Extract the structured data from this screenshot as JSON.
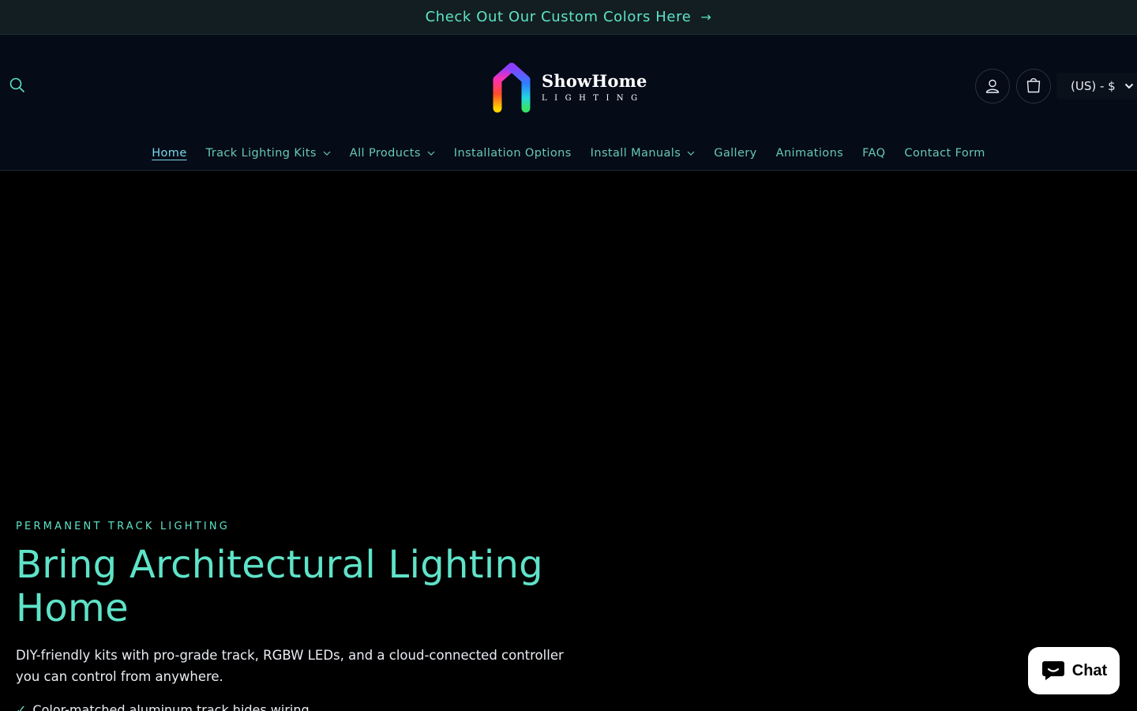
{
  "announcement": {
    "text": "Check Out Our Custom Colors Here",
    "arrow": "→"
  },
  "header": {
    "logo": {
      "name": "ShowHome",
      "sub": "LIGHTING"
    },
    "currency": {
      "label": "(US) - $"
    }
  },
  "nav": {
    "items": [
      {
        "label": "Home",
        "active": true,
        "dropdown": false
      },
      {
        "label": "Track Lighting Kits",
        "dropdown": true
      },
      {
        "label": "All Products",
        "dropdown": true
      },
      {
        "label": "Installation Options",
        "dropdown": false
      },
      {
        "label": "Install Manuals",
        "dropdown": true
      },
      {
        "label": "Gallery",
        "dropdown": false
      },
      {
        "label": "Animations",
        "dropdown": false
      },
      {
        "label": "FAQ",
        "dropdown": false
      },
      {
        "label": "Contact Form",
        "dropdown": false
      }
    ]
  },
  "hero": {
    "eyebrow": "PERMANENT TRACK LIGHTING",
    "title": "Bring Architectural Lighting Home",
    "description": "DIY-friendly kits with pro-grade track, RGBW LEDs, and a cloud-connected controller you can control from anywhere.",
    "bullet": "Color-matched aluminum track hides wiring",
    "bullet_mark": "✓"
  },
  "chat": {
    "label": "Chat"
  },
  "colors": {
    "accent": "#5fe3c8",
    "header_bg": "#050b17",
    "announce_bg": "#121e21"
  }
}
